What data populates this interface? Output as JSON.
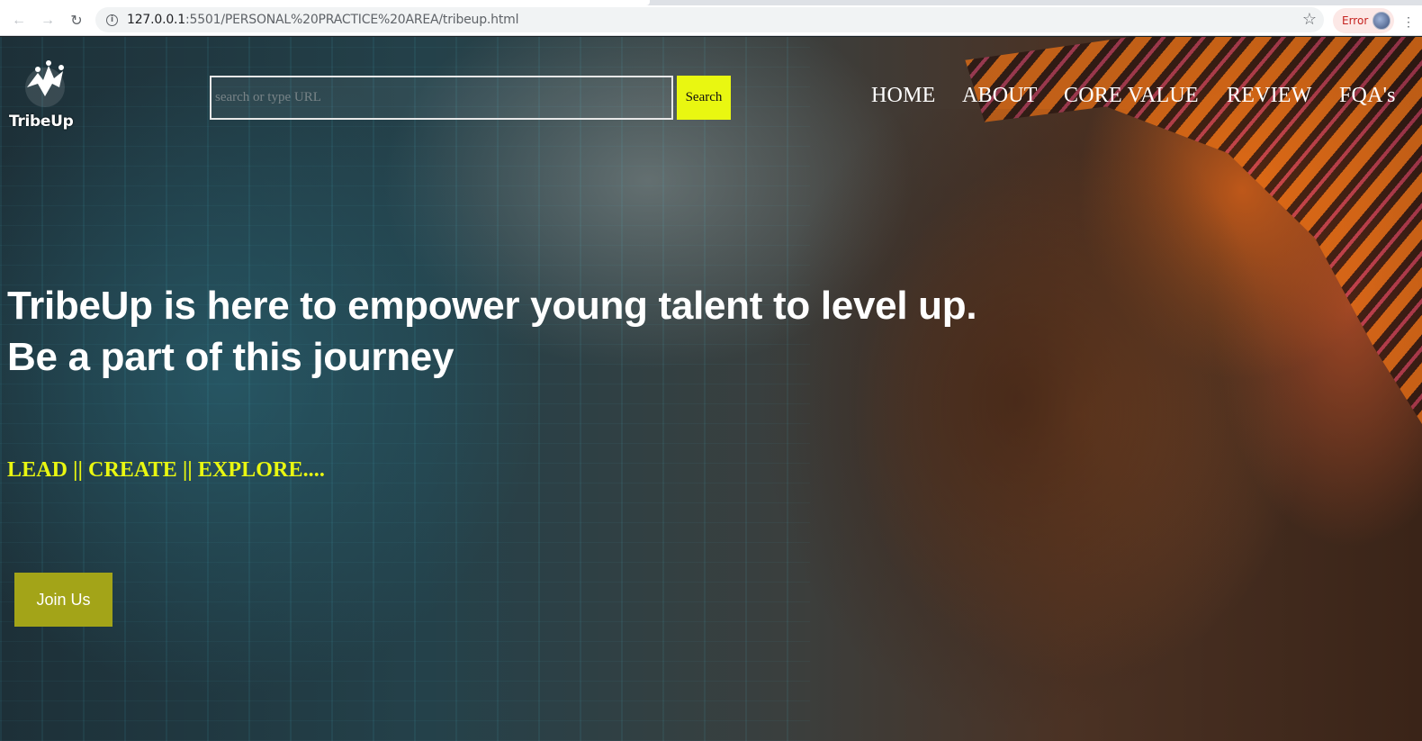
{
  "browser": {
    "url_host": "127.0.0.1",
    "url_path": ":5501/PERSONAL%20PRACTICE%20AREA/tribeup.html",
    "error_label": "Error",
    "icons": [
      "back-icon",
      "forward-icon",
      "reload-icon",
      "info-icon",
      "star-icon",
      "avatar"
    ]
  },
  "header": {
    "logo_text": "TribeUp",
    "search_placeholder": "search or type URL",
    "search_button": "Search",
    "nav": [
      "HOME",
      "ABOUT",
      "CORE VALUE",
      "REVIEW",
      "FQA's"
    ]
  },
  "hero": {
    "headline_line1": "TribeUp is here to empower young talent to level up.",
    "headline_line2": "Be a part of this journey",
    "tagline": "LEAD || CREATE || EXPLORE....",
    "cta": "Join Us"
  },
  "colors": {
    "accent_yellow": "#e9f711",
    "button_olive": "#a3a418"
  }
}
